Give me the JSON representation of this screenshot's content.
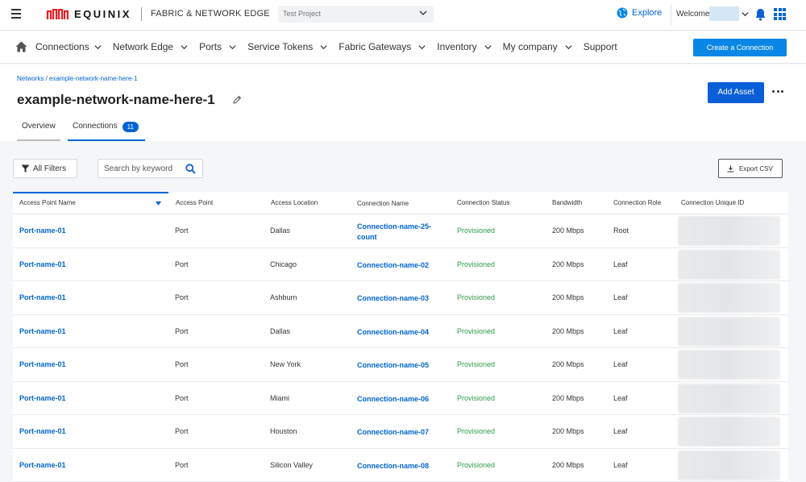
{
  "header": {
    "brand": "EQUINIX",
    "product": "FABRIC & NETWORK EDGE",
    "project": "Test Project",
    "explore": "Explore",
    "welcome": "Welcome,"
  },
  "nav": {
    "items": [
      {
        "label": "Connections"
      },
      {
        "label": "Network Edge"
      },
      {
        "label": "Ports"
      },
      {
        "label": "Service Tokens"
      },
      {
        "label": "Fabric Gateways"
      },
      {
        "label": "Inventory"
      },
      {
        "label": "My company"
      },
      {
        "label": "Support"
      }
    ],
    "create": "Create a Connection"
  },
  "page": {
    "breadcrumb": "Networks / example-network-name-here-1",
    "title": "example-network-name-here-1",
    "add_asset": "Add Asset",
    "tabs": {
      "overview": "Overview",
      "connections": "Connections",
      "connections_count": "11"
    }
  },
  "toolbar": {
    "filters": "All Filters",
    "search_placeholder": "Search by keyword",
    "export": "Export CSV"
  },
  "table": {
    "columns": [
      "Access Point Name",
      "Access Point",
      "Access Location",
      "Connection Name",
      "Connection Status",
      "Bandwidth",
      "Connection Role",
      "Connection Unique ID"
    ],
    "rows": [
      {
        "ap_name": "Port-name-01",
        "ap": "Port",
        "location": "Dallas",
        "conn": "Connection-name-25-count",
        "status": "Provisioned",
        "bw": "200 Mbps",
        "role": "Root"
      },
      {
        "ap_name": "Port-name-01",
        "ap": "Port",
        "location": "Chicago",
        "conn": "Connection-name-02",
        "status": "Provisioned",
        "bw": "200 Mbps",
        "role": "Leaf"
      },
      {
        "ap_name": "Port-name-01",
        "ap": "Port",
        "location": "Ashburn",
        "conn": "Connection-name-03",
        "status": "Provisioned",
        "bw": "200 Mbps",
        "role": "Leaf"
      },
      {
        "ap_name": "Port-name-01",
        "ap": "Port",
        "location": "Dallas",
        "conn": "Connection-name-04",
        "status": "Provisioned",
        "bw": "200 Mbps",
        "role": "Leaf"
      },
      {
        "ap_name": "Port-name-01",
        "ap": "Port",
        "location": "New York",
        "conn": "Connection-name-05",
        "status": "Provisioned",
        "bw": "200 Mbps",
        "role": "Leaf"
      },
      {
        "ap_name": "Port-name-01",
        "ap": "Port",
        "location": "Miami",
        "conn": "Connection-name-06",
        "status": "Provisioned",
        "bw": "200 Mbps",
        "role": "Leaf"
      },
      {
        "ap_name": "Port-name-01",
        "ap": "Port",
        "location": "Houston",
        "conn": "Connection-name-07",
        "status": "Provisioned",
        "bw": "200 Mbps",
        "role": "Leaf"
      },
      {
        "ap_name": "Port-name-01",
        "ap": "Port",
        "location": "Silicon Valley",
        "conn": "Connection-name-08",
        "status": "Provisioned",
        "bw": "200 Mbps",
        "role": "Leaf"
      }
    ]
  },
  "colors": {
    "brand_red": "#e91c24",
    "primary_blue": "#0064d2",
    "status_green": "#2e9c4a"
  },
  "icons": [
    "hamburger-icon",
    "globe-icon",
    "bell-icon",
    "apps-grid-icon",
    "home-icon",
    "chevron-down-icon",
    "pencil-icon",
    "more-icon",
    "filter-icon",
    "search-icon",
    "download-icon",
    "sort-icon"
  ]
}
